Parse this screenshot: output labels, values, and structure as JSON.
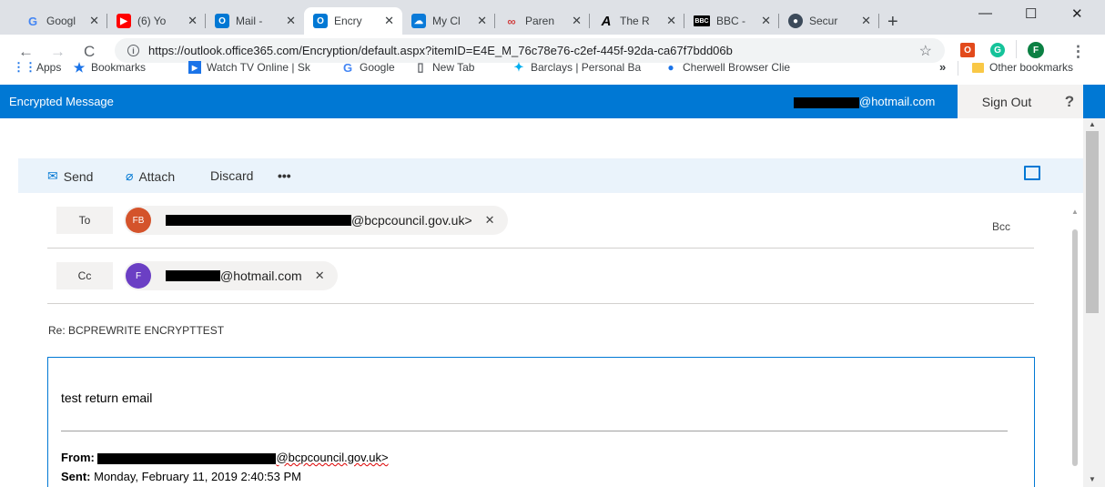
{
  "browser": {
    "tabs": [
      {
        "title": "Googl",
        "icon": "google-icon",
        "color": "#4285f4"
      },
      {
        "title": "(6) Yo",
        "icon": "youtube-icon",
        "color": "#ff0000"
      },
      {
        "title": "Mail -",
        "icon": "outlook-icon",
        "color": "#0078d4"
      },
      {
        "title": "Encry",
        "icon": "outlook-icon",
        "color": "#0078d4"
      },
      {
        "title": "My Cl",
        "icon": "cloud-icon",
        "color": "#0a7ad8"
      },
      {
        "title": "Paren",
        "icon": "link-icon",
        "color": "#d04040"
      },
      {
        "title": "The R",
        "icon": "the-r-icon",
        "color": "#000000"
      },
      {
        "title": "BBC -",
        "icon": "bbc-icon",
        "color": "#000000"
      },
      {
        "title": "Secur",
        "icon": "globe-icon",
        "color": "#3c4a5a"
      }
    ],
    "new_tab": "+",
    "window": {
      "minimize": "—",
      "maximize": "☐",
      "close": "✕"
    },
    "url": "https://outlook.office365.com/Encryption/default.aspx?itemID=E4E_M_76c78e76-c2ef-445f-92da-ca67f7bdd06b",
    "bookmarks": [
      {
        "label": "Apps",
        "icon": "apps-icon"
      },
      {
        "label": "Bookmarks",
        "icon": "star-icon"
      },
      {
        "label": "Watch TV Online | Sk",
        "icon": "play-icon"
      },
      {
        "label": "Google",
        "icon": "google-icon"
      },
      {
        "label": "New Tab",
        "icon": "page-icon"
      },
      {
        "label": "Barclays | Personal Ba",
        "icon": "barclays-icon"
      },
      {
        "label": "Cherwell Browser Clie",
        "icon": "cherwell-icon"
      }
    ],
    "bookmarks_overflow": "»",
    "other_bookmarks": "Other bookmarks",
    "profile_initial": "F"
  },
  "owa": {
    "header_title": "Encrypted Message",
    "account_domain": "@hotmail.com",
    "sign_out": "Sign Out",
    "help": "?",
    "toolbar": {
      "send": "Send",
      "attach": "Attach",
      "discard": "Discard",
      "more": "•••"
    },
    "to_label": "To",
    "cc_label": "Cc",
    "bcc_label": "Bcc",
    "to_recipient": {
      "initials": "FB",
      "address_suffix": "@bcpcouncil.gov.uk>",
      "avatar_color": "#d4532b"
    },
    "cc_recipient": {
      "initials": "F",
      "address_suffix": "@hotmail.com",
      "avatar_color": "#6b3fc4"
    },
    "remove": "✕",
    "subject": "Re: BCPREWRITE  ENCRYPTTEST",
    "body_text": "test return email",
    "from_label": "From:",
    "from_suffix": "@bcpcouncil.gov.uk>",
    "sent_label": "Sent:",
    "sent_value": "Monday, February 11, 2019 2:40:53 PM"
  }
}
